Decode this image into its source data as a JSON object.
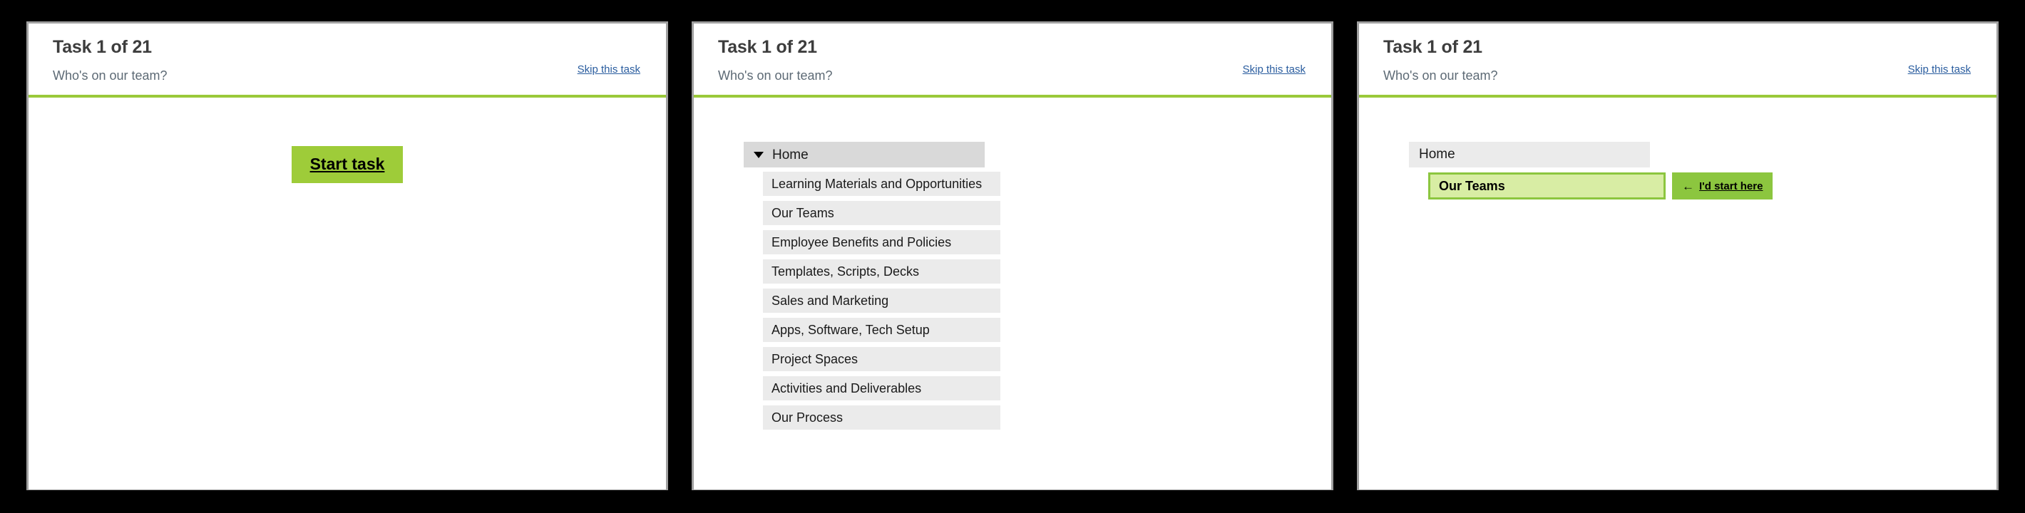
{
  "theme": {
    "accent_green": "#9ac93a",
    "button_green": "#9ecc39",
    "target_fill": "#d8eda4",
    "target_border": "#8cc63f",
    "link_blue": "#2a5d9f",
    "row_grey": "#ebebeb",
    "root_grey": "#d9d9d9",
    "frame_black": "#000000",
    "panel_border": "#a0a0a0"
  },
  "header": {
    "task_title": "Task 1 of 21",
    "task_subtitle": "Who's on our team?",
    "skip_label": "Skip this task"
  },
  "panel1": {
    "start_task_label": "Start task"
  },
  "panel2": {
    "root": {
      "label": "Home",
      "caret": "caret-down-icon"
    },
    "children": [
      {
        "label": "Learning Materials and Opportunities"
      },
      {
        "label": "Our Teams"
      },
      {
        "label": "Employee Benefits and Policies"
      },
      {
        "label": "Templates, Scripts, Decks"
      },
      {
        "label": "Sales and Marketing"
      },
      {
        "label": "Apps, Software, Tech Setup"
      },
      {
        "label": "Project Spaces"
      },
      {
        "label": "Activities and Deliverables"
      },
      {
        "label": "Our Process"
      }
    ]
  },
  "panel3": {
    "root_label": "Home",
    "selected_label": "Our Teams",
    "start_here_arrow": "←",
    "start_here_label": "I'd start here"
  }
}
